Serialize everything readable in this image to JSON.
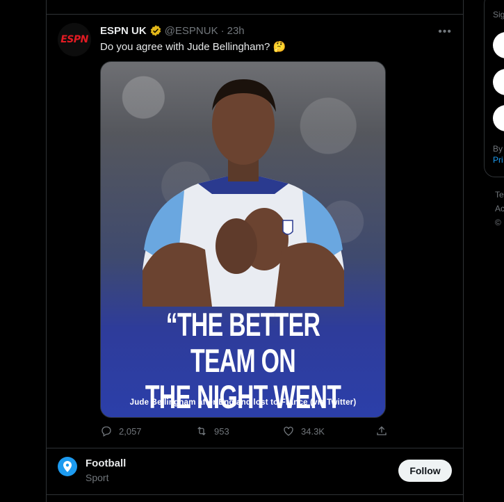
{
  "tweet": {
    "name": "ESPN UK",
    "handle": "@ESPNUK",
    "dot": "·",
    "time": "23h",
    "text": "Do you agree with Jude Bellingham? 🤔",
    "avatar_logo": "ESPN",
    "media": {
      "quote_line1": "“THE BETTER TEAM ON",
      "quote_line2": "THE NIGHT WENT OUT”",
      "caption": "Jude Bellingham after England lost to France (via Twitter)"
    },
    "actions": {
      "replies": "2,057",
      "retweets": "953",
      "likes": "34.3K"
    }
  },
  "topic": {
    "name": "Football",
    "category": "Sport",
    "follow_label": "Follow"
  },
  "sidebar": {
    "sign_fragment": "Sig",
    "by_fragment": "By",
    "pri_fragment": "Pri",
    "footer_1": "Te",
    "footer_2": "Ac",
    "footer_3": "©"
  },
  "colors": {
    "background": "#000000",
    "border": "#2f3336",
    "muted": "#71767b",
    "accent": "#1d9bf0",
    "verified": "#e2b719"
  }
}
